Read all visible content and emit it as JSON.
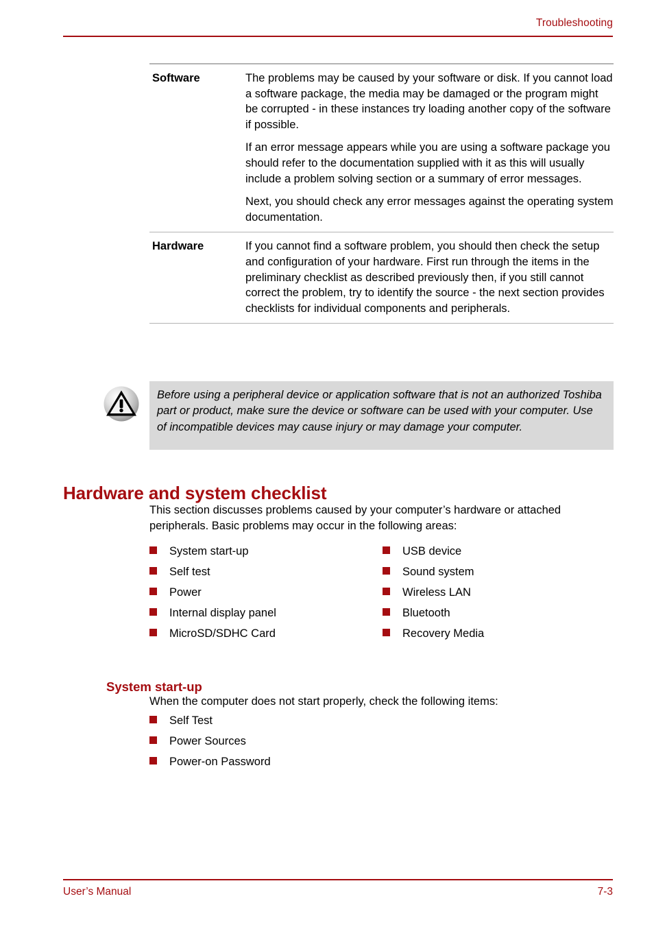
{
  "colors": {
    "accent_red": "#a50d11",
    "rule_gray": "#b3b3b3",
    "caution_background": "#d9d9d9",
    "body_text": "#000000"
  },
  "header": {
    "title": "Troubleshooting"
  },
  "definition_table": {
    "rows": [
      {
        "term": "Software",
        "paragraphs": [
          "The problems may be caused by your software or disk. If you cannot load a software package, the media may be damaged or the program might be corrupted - in these instances try loading another copy of the software if possible.",
          "If an error message appears while you are using a software package you should refer to the documentation supplied with it as this will usually include a problem solving section or a summary of error messages.",
          "Next, you should check any error messages against the operating system documentation."
        ]
      },
      {
        "term": "Hardware",
        "paragraphs": [
          "If you cannot find a software problem, you should then check the setup and configuration of your hardware. First run through the items in the preliminary checklist as described previously then, if you still cannot correct the problem, try to identify the source - the next section provides checklists for individual components and peripherals."
        ]
      }
    ]
  },
  "caution": {
    "icon": "warning-triangle-icon",
    "text": "Before using a peripheral device or application software that is not an authorized Toshiba part or product, make sure the device or software can be used with your computer. Use of incompatible devices may cause injury or may damage your computer."
  },
  "section": {
    "heading": "Hardware and system checklist",
    "intro": "This section discusses problems caused by your computer’s hardware or attached peripherals. Basic problems may occur in the following areas:",
    "checklist_column_left": [
      "System start-up",
      "Self test",
      "Power",
      "Internal display panel",
      "MicroSD/SDHC Card"
    ],
    "checklist_column_right": [
      "USB device",
      "Sound system",
      "Wireless LAN",
      "Bluetooth",
      "Recovery Media"
    ]
  },
  "subsection": {
    "heading": "System start-up",
    "intro": "When the computer does not start properly, check the following items:",
    "items": [
      "Self Test",
      "Power Sources",
      "Power-on Password"
    ]
  },
  "footer": {
    "manual_label": "User’s Manual",
    "page_number": "7-3"
  }
}
